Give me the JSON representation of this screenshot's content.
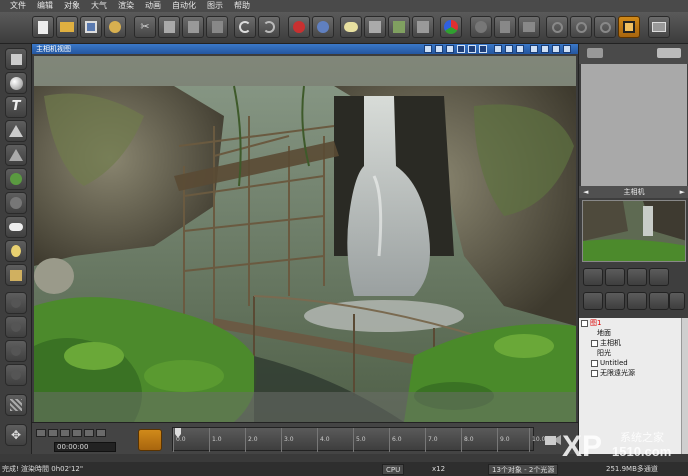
{
  "menu": [
    "文件",
    "编辑",
    "对象",
    "大气",
    "渲染",
    "动画",
    "自动化",
    "图示",
    "帮助"
  ],
  "toolbar_icons": [
    "new-icon",
    "open-icon",
    "save-icon",
    "import-icon",
    "cut-icon",
    "copy-icon",
    "paste-icon",
    "duplicate-icon",
    "undo-icon",
    "redo-icon",
    "render-icon",
    "render-area-icon",
    "atmosphere-icon",
    "object-icon",
    "material-icon",
    "terrain-icon",
    "color-icon",
    "zoom-icon",
    "chart-icon",
    "graph-icon",
    "search-icon",
    "zoom-in-icon",
    "zoom-out-icon",
    "pan-icon",
    "window-icon"
  ],
  "viewport": {
    "title": "主相机视图"
  },
  "right_panel": {
    "camera_header": "主相机",
    "tree": [
      {
        "label": "图1",
        "selected": true
      },
      {
        "label": "地面"
      },
      {
        "label": "主相机"
      },
      {
        "label": "阳光"
      },
      {
        "label": "Untitled"
      },
      {
        "label": "无限遠光源"
      }
    ]
  },
  "timeline": {
    "ticks": [
      "0.0",
      "1.0",
      "2.0",
      "3.0",
      "4.0",
      "5.0",
      "6.0",
      "7.0",
      "8.0",
      "9.0",
      "10.0"
    ],
    "time_value": "00:00:00"
  },
  "status": {
    "left": "完成! 渲染時間 0h02'12\"",
    "cpu": "CPU",
    "zoom": "x12",
    "objects": "13个对象 - 2个光源",
    "memory": "251.9MB多通道"
  },
  "watermark": {
    "text_main": "XP",
    "text_cn": "系统之家",
    "url": "1510.com"
  }
}
